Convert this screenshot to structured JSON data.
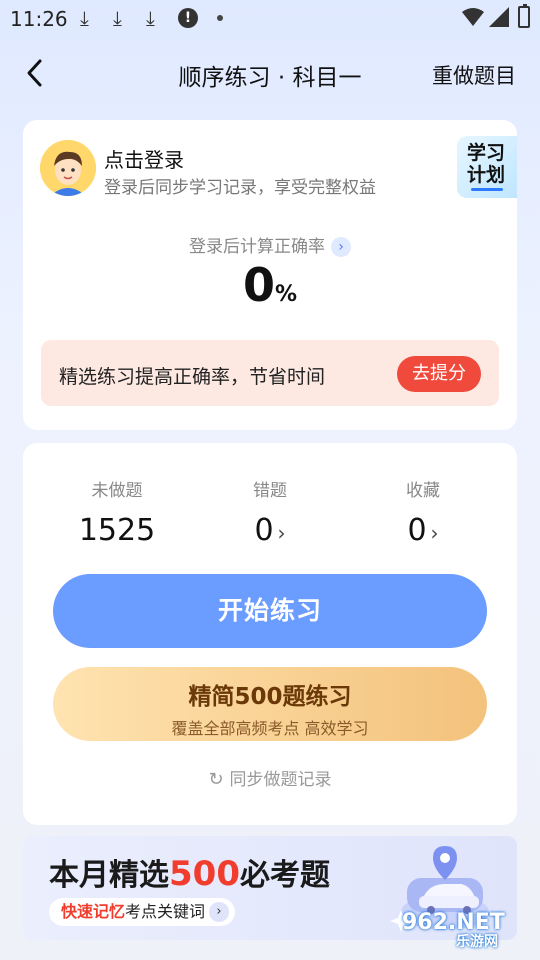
{
  "status": {
    "time": "11:26"
  },
  "nav": {
    "title": "顺序练习 · 科目一",
    "redo_label": "重做题目"
  },
  "login": {
    "title": "点击登录",
    "subtitle": "登录后同步学习记录，享受完整权益"
  },
  "plan": {
    "line1": "学习",
    "line2": "计划"
  },
  "accuracy": {
    "label": "登录后计算正确率",
    "value": "0",
    "unit": "%"
  },
  "promo": {
    "text": "精选练习提高正确率，节省时间",
    "button": "去提分"
  },
  "stats": [
    {
      "label": "未做题",
      "value": "1525"
    },
    {
      "label": "错题",
      "value": "0"
    },
    {
      "label": "收藏",
      "value": "0"
    }
  ],
  "buttons": {
    "start": "开始练习",
    "compact_title": "精简500题练习",
    "compact_sub": "覆盖全部高频考点 高效学习"
  },
  "sync": {
    "label": "同步做题记录"
  },
  "banner": {
    "part1": "本月精选",
    "highlight": "500",
    "part2": "必考题",
    "pill_red": "快速记忆",
    "pill_text": "考点关键词"
  },
  "watermark": {
    "line1": "962.NET",
    "line2": "乐游网"
  },
  "colors": {
    "accent_blue": "#6b9cff",
    "accent_red": "#f04a3c",
    "gold": "#f3c27c"
  }
}
